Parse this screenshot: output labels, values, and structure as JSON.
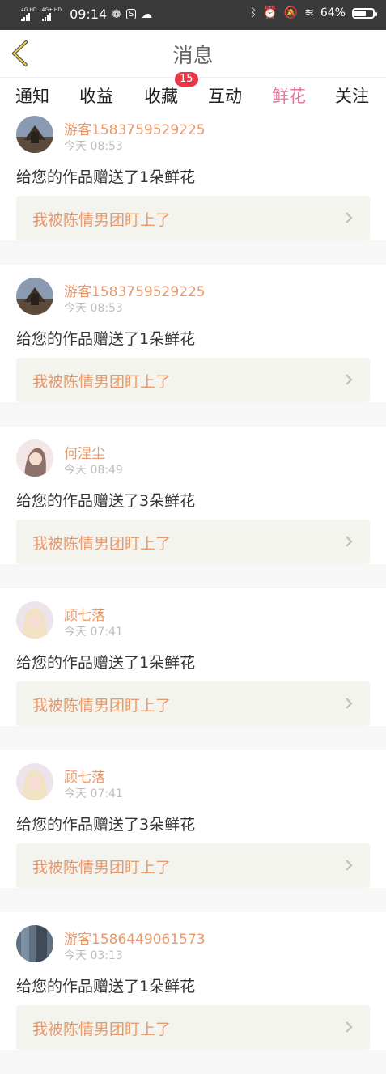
{
  "status_bar": {
    "network1": "4G HD",
    "network2": "4G+ HD",
    "time": "09:14",
    "battery": "64%",
    "battery_level": 0.64
  },
  "header": {
    "title": "消息"
  },
  "tabs": [
    {
      "label": "通知"
    },
    {
      "label": "收益"
    },
    {
      "label": "收藏",
      "badge": "15"
    },
    {
      "label": "互动"
    },
    {
      "label": "鲜花"
    },
    {
      "label": "关注"
    }
  ],
  "items": [
    {
      "user": "游客1583759529225",
      "time": "今天 08:53",
      "message": "给您的作品赠送了1朵鲜花",
      "work": "我被陈情男团盯上了"
    },
    {
      "user": "游客1583759529225",
      "time": "今天 08:53",
      "message": "给您的作品赠送了1朵鲜花",
      "work": "我被陈情男团盯上了"
    },
    {
      "user": "何涅尘",
      "time": "今天 08:49",
      "message": "给您的作品赠送了3朵鲜花",
      "work": "我被陈情男团盯上了"
    },
    {
      "user": "顾七落",
      "time": "今天 07:41",
      "message": "给您的作品赠送了1朵鲜花",
      "work": "我被陈情男团盯上了"
    },
    {
      "user": "顾七落",
      "time": "今天 07:41",
      "message": "给您的作品赠送了3朵鲜花",
      "work": "我被陈情男团盯上了"
    },
    {
      "user": "游客1586449061573",
      "time": "今天 03:13",
      "message": "给您的作品赠送了1朵鲜花",
      "work": "我被陈情男团盯上了"
    }
  ],
  "colors": {
    "accent": "#e4789a",
    "username": "#e79a6d",
    "badge": "#e8394b"
  }
}
